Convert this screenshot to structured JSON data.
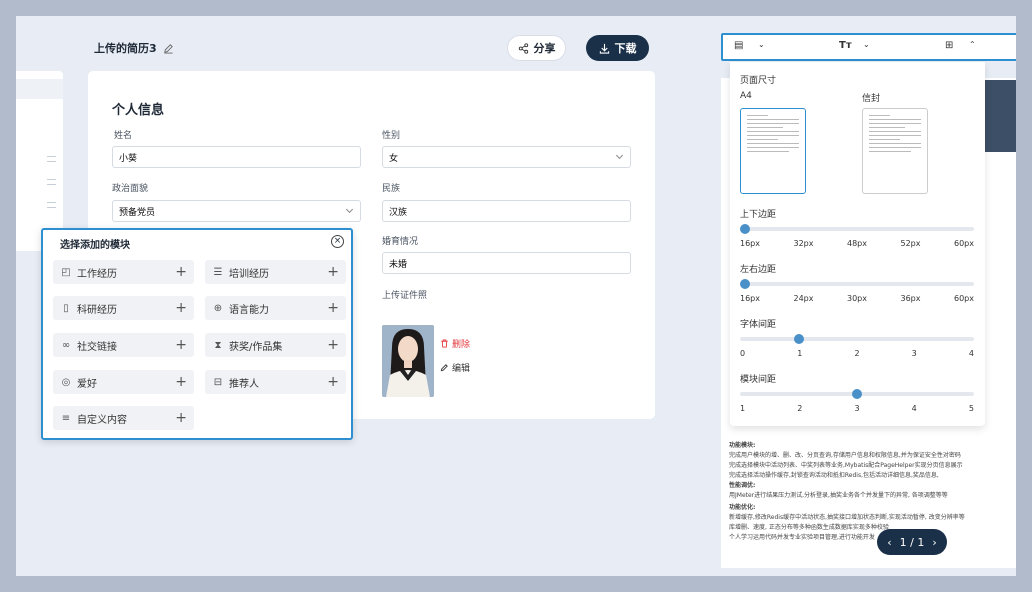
{
  "header": {
    "title": "上传的简历3",
    "share_label": "分享",
    "download_label": "下载"
  },
  "form": {
    "section_title": "个人信息",
    "name_label": "姓名",
    "name_value": "小葵",
    "gender_label": "性别",
    "gender_value": "女",
    "politics_label": "政治面貌",
    "politics_value": "预备党员",
    "ethnicity_label": "民族",
    "ethnicity_value": "汉族",
    "marital_label": "婚育情况",
    "marital_value": "未婚",
    "photo_label": "上传证件照",
    "delete_label": "删除",
    "edit_label": "编辑"
  },
  "modules": {
    "title": "选择添加的模块",
    "items": [
      {
        "label": "工作经历",
        "icon": "briefcase-icon"
      },
      {
        "label": "培训经历",
        "icon": "database-icon"
      },
      {
        "label": "科研经历",
        "icon": "book-icon"
      },
      {
        "label": "语言能力",
        "icon": "globe-icon"
      },
      {
        "label": "社交链接",
        "icon": "link-icon"
      },
      {
        "label": "获奖/作品集",
        "icon": "hourglass-icon"
      },
      {
        "label": "爱好",
        "icon": "camera-icon"
      },
      {
        "label": "推荐人",
        "icon": "inbox-icon"
      },
      {
        "label": "自定义内容",
        "icon": "menu-icon"
      }
    ]
  },
  "settings": {
    "page_size_label": "页面尺寸",
    "size_a4": "A4",
    "size_envelope": "信封",
    "margin_tb_label": "上下边距",
    "margin_tb_ticks": [
      "16px",
      "32px",
      "48px",
      "52px",
      "60px"
    ],
    "margin_tb_value": 0,
    "margin_lr_label": "左右边距",
    "margin_lr_ticks": [
      "16px",
      "24px",
      "30px",
      "36px",
      "60px"
    ],
    "margin_lr_value": 0,
    "letter_spacing_label": "字体间距",
    "letter_spacing_ticks": [
      "0",
      "1",
      "2",
      "3",
      "4"
    ],
    "letter_spacing_value": 0.25,
    "module_spacing_label": "模块间距",
    "module_spacing_ticks": [
      "1",
      "2",
      "3",
      "4",
      "5"
    ],
    "module_spacing_value": 0.5
  },
  "preview": {
    "lines": [
      "功能模块:",
      "完成用户模块的增、删、改、分页查询,存储用户信息和权限信息,并为保证安全性对密码",
      "完成选择模块中活动列表、中奖列表等业务,Mybatis配合PageHelper实现分页信息展示",
      "完成选择活动操作缓存,封锁查询活动和抵扣Redis,包括活动详细信息,奖品信息,",
      "性能调优:",
      "用JMeter进行结果压力测试,分析登录,抽奖业务各个并发量下的异常, 各项调整等等",
      "功能优化:",
      "新增缓存,修改Redis缓存中活动状态,抽奖接口增加状态判断,实现活动暂停, 改变分辨率等",
      "库增删、速度, 正态分布等多种函数生成数据库实现多种校验",
      "个人学习运用代码并发专业实验项目管理,进行功能开发"
    ],
    "page_indicator": "1 / 1"
  }
}
